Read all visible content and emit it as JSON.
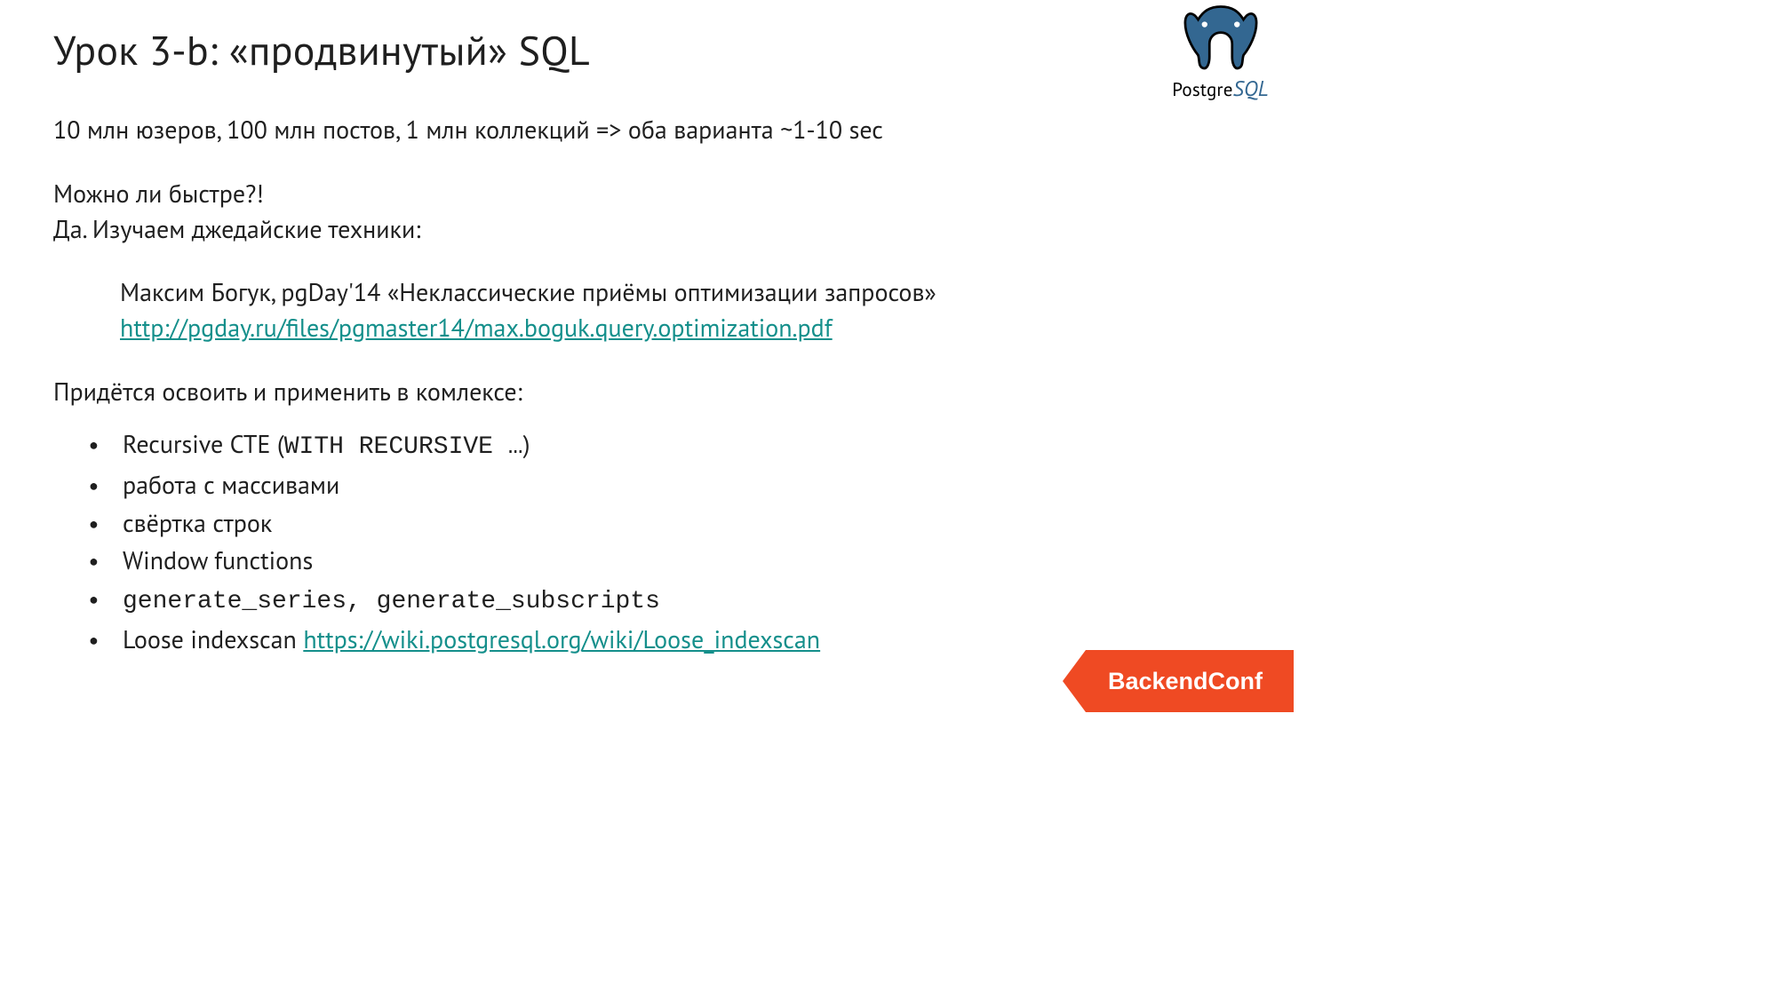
{
  "logo": {
    "word_prefix": "Postgre",
    "word_suffix": "SQL"
  },
  "ribbon": {
    "label": "BackendConf"
  },
  "slide": {
    "title": "Урок 3-b: «продвинутый» SQL",
    "intro_line": "10 млн юзеров, 100 млн постов, 1 млн коллекций => оба варианта  ~1-10 sec",
    "faster_q": "Можно ли быстре?!",
    "faster_a": "Да. Изучаем джедайские техники:",
    "ref": {
      "text": "Максим Богук, pgDay'14 «Неклассические приёмы оптимизации запросов»",
      "link": "http://pgday.ru/files/pgmaster14/max.boguk.query.optimization.pdf"
    },
    "complex_intro": "Придётся освоить и применить в комлексе:",
    "bullets": {
      "b1_pre": "Recursive CTE (",
      "b1_mono": "WITH RECURSIVE …",
      "b1_post": ")",
      "b2": "работа с массивами",
      "b3": "свёртка строк",
      "b4": "Window functions",
      "b5_mono": "generate_series, generate_subscripts",
      "b6_pre": "Loose indexscan ",
      "b6_link": "https://wiki.postgresql.org/wiki/Loose_indexscan"
    }
  }
}
